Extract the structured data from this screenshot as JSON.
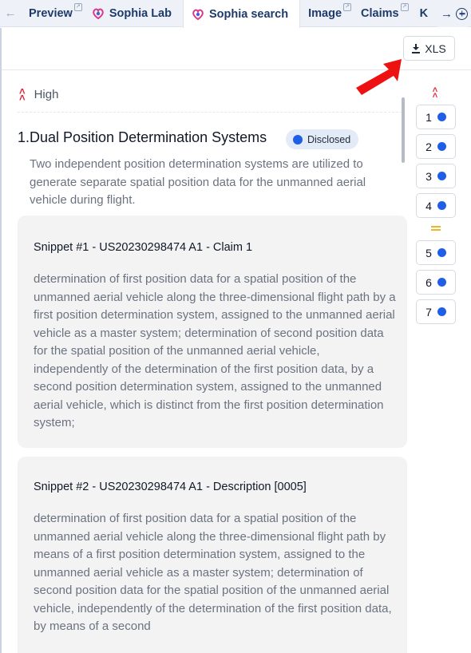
{
  "tabs": [
    {
      "label": "Preview",
      "external": true
    },
    {
      "label": "Sophia Lab",
      "logo": true
    },
    {
      "label": "Sophia search",
      "logo": true,
      "active": true
    },
    {
      "label": "Image",
      "external": true
    },
    {
      "label": "Claims",
      "external": true
    },
    {
      "label": "K"
    }
  ],
  "toolbar": {
    "export_label": "XLS"
  },
  "group": {
    "label": "High"
  },
  "item": {
    "title": "1.Dual Position Determination Systems",
    "badge": "Disclosed",
    "description": "Two independent position determination systems are utilized to generate separate spatial position data for the unmanned aerial vehicle during flight."
  },
  "snippets": [
    {
      "title": "Snippet #1 - US20230298474 A1 - Claim 1",
      "text": "determination of first position data for a spatial position of the unmanned aerial vehicle along the three-dimensional flight path by a first position determination system, assigned to the unmanned aerial vehicle as a master system; determination of second position data for the spatial position of the unmanned aerial vehicle, independently of the determination of the first position data, by a second position determination system, assigned to the unmanned aerial vehicle, which is distinct from the first position determination system;"
    },
    {
      "title": "Snippet #2 - US20230298474 A1 - Description [0005]",
      "text": "determination of first position data for a spatial position of the unmanned aerial vehicle along the three-dimensional flight path by means of a first position determination system, assigned to the unmanned aerial vehicle as a master system; determination of second position data for the spatial position of the unmanned aerial vehicle, independently of the determination of the first position data, by means of a second"
    }
  ],
  "navigator": {
    "items": [
      "1",
      "2",
      "3",
      "4",
      "5",
      "6",
      "7"
    ]
  },
  "colors": {
    "accent": "#1f5fe8",
    "priority_high": "#e0253a",
    "priority_medium": "#f0b429",
    "arrow": "#ee1111"
  }
}
